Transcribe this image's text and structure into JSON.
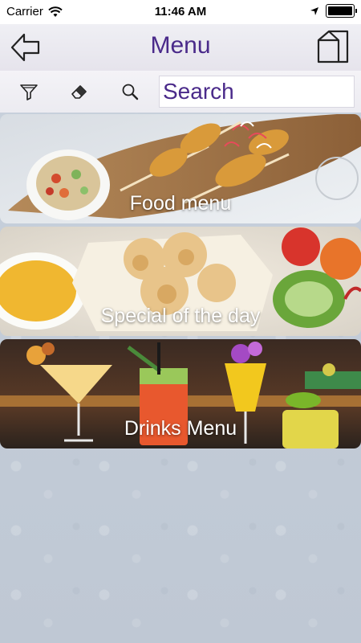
{
  "status_bar": {
    "carrier": "Carrier",
    "time": "11:46 AM"
  },
  "nav": {
    "title": "Menu",
    "back_icon": "back-arrow-icon",
    "home_icon": "home-icon"
  },
  "toolbar": {
    "filter_icon": "filter-funnel-icon",
    "clear_icon": "eraser-icon",
    "search_icon": "magnifier-icon",
    "search_placeholder": "Search"
  },
  "menu_items": [
    {
      "label": "Food menu"
    },
    {
      "label": "Special of the day"
    },
    {
      "label": "Drinks Menu"
    }
  ],
  "colors": {
    "title_purple": "#4a2a8a",
    "background": "#c5ceda"
  }
}
